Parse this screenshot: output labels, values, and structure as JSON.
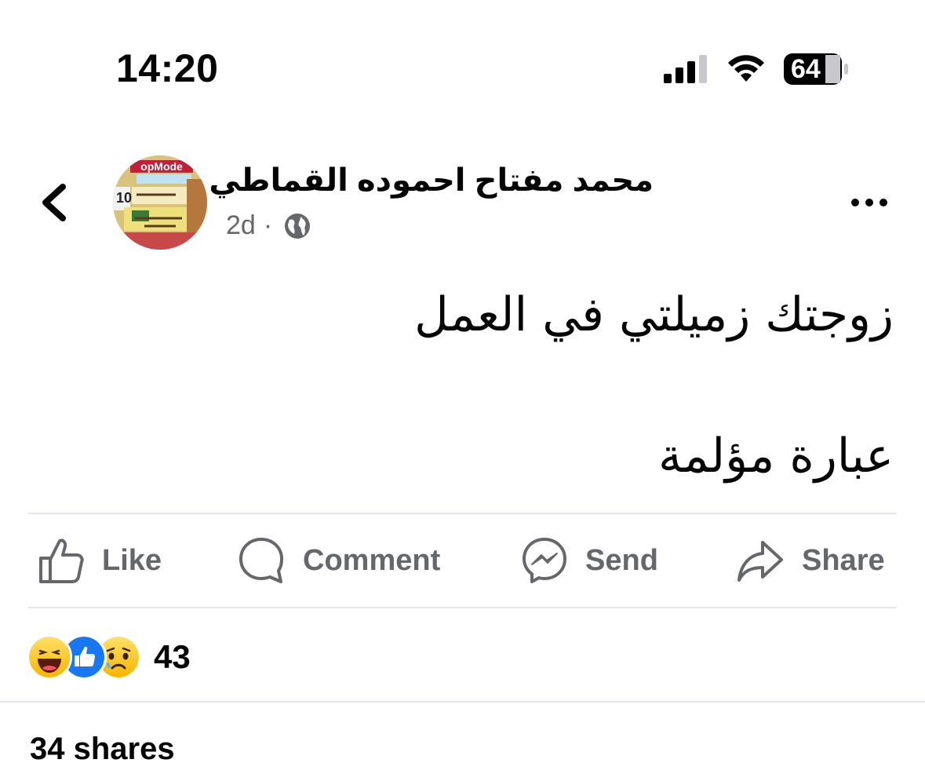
{
  "status_bar": {
    "time": "14:20",
    "battery_level": "64"
  },
  "post": {
    "author_name": "محمد مفتاح احموده القماطي",
    "timestamp": "2d",
    "separator": "·",
    "audience_icon": "globe-icon",
    "text_line_1": "زوجتك زميلتي في العمل",
    "text_line_2": "عبارة مؤلمة"
  },
  "actions": {
    "like_label": "Like",
    "comment_label": "Comment",
    "send_label": "Send",
    "share_label": "Share"
  },
  "stats": {
    "reactions": [
      "haha-emoji",
      "like-emoji",
      "sad-emoji"
    ],
    "reaction_count": "43",
    "shares_text": "34 shares"
  },
  "colors": {
    "secondary_text": "#65676b",
    "like_blue": "#1877f2",
    "divider": "#e4e6eb"
  }
}
